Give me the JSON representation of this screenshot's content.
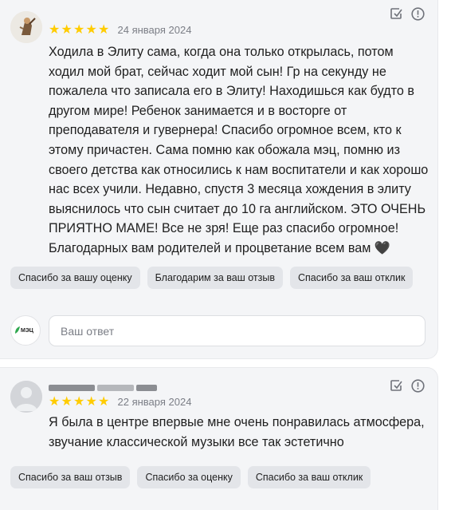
{
  "reviews": [
    {
      "author_name": "",
      "rating": 5,
      "date": "24 января 2024",
      "text": "Ходила в Элиту сама, когда она только открылась, потом ходил мой брат, сейчас ходит мой сын! Гр на секунду не пожалела что записала его в Элиту! Находишься как будто в другом мире! Ребенок занимается и в восторге от преподавателя и гувернера! Спасибо огромное всем, кто к этому причастен. Сама помню как обожала мэц, помню из своего детства как относились к нам воспитатели и как хорошо нас всех учили. Недавно, спустя 3 месяца хождения в элиту выяснилось что сын считает до 10 га английском. ЭТО ОЧЕНЬ ПРИЯТНО МАМЕ! Все не зря! Еще раз спасибо огромное! Благодарных вам родителей и процветание всем вам 🖤",
      "chips": [
        "Спасибо за вашу оценку",
        "Благодарим за ваш отзыв",
        "Спасибо за ваш отклик"
      ],
      "reply": {
        "logo_text": "МЭЦ",
        "placeholder": "Ваш ответ"
      }
    },
    {
      "author_name": "",
      "rating": 5,
      "date": "22 января 2024",
      "text": "Я была в центре впервые мне очень понравилась атмосфера, звучание классической музыки все так эстетично",
      "chips": [
        "Спасибо за ваш отзыв",
        "Спасибо за оценку",
        "Спасибо за ваш отклик"
      ]
    }
  ],
  "icons": {
    "edit": "edit-check-icon",
    "report": "report-icon",
    "star": "star-icon"
  },
  "colors": {
    "star": "#ffcc00",
    "card_bg": "#f4f5f7",
    "chip_bg": "#e3e5e9",
    "logo_green": "#2fa84f"
  }
}
